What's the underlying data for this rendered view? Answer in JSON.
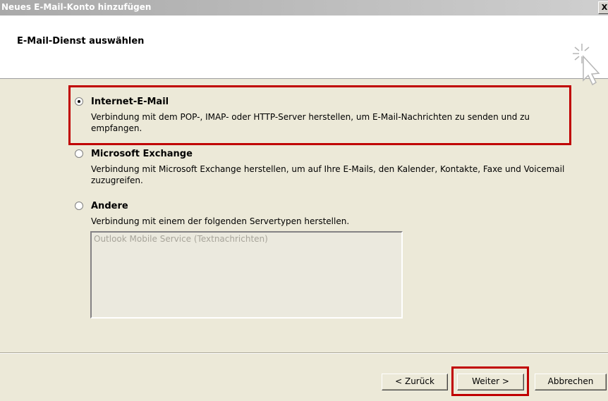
{
  "window": {
    "title": "Neues E-Mail-Konto hinzufügen",
    "close_label": "X"
  },
  "header": {
    "title": "E-Mail-Dienst auswählen"
  },
  "options": [
    {
      "label": "Internet-E-Mail",
      "description": "Verbindung mit dem POP-, IMAP- oder HTTP-Server herstellen, um E-Mail-Nachrichten zu senden und zu empfangen.",
      "selected": true
    },
    {
      "label": "Microsoft Exchange",
      "description": "Verbindung mit Microsoft Exchange herstellen, um auf Ihre E-Mails, den Kalender, Kontakte, Faxe und Voicemail zuzugreifen.",
      "selected": false
    },
    {
      "label": "Andere",
      "description": "Verbindung mit einem der folgenden Servertypen herstellen.",
      "selected": false
    }
  ],
  "server_types": [
    "Outlook Mobile Service (Textnachrichten)"
  ],
  "buttons": {
    "back": "< Zurück",
    "next": "Weiter >",
    "cancel": "Abbrechen"
  },
  "colors": {
    "highlight": "#c00000",
    "dialog_bg": "#ece9d8"
  }
}
